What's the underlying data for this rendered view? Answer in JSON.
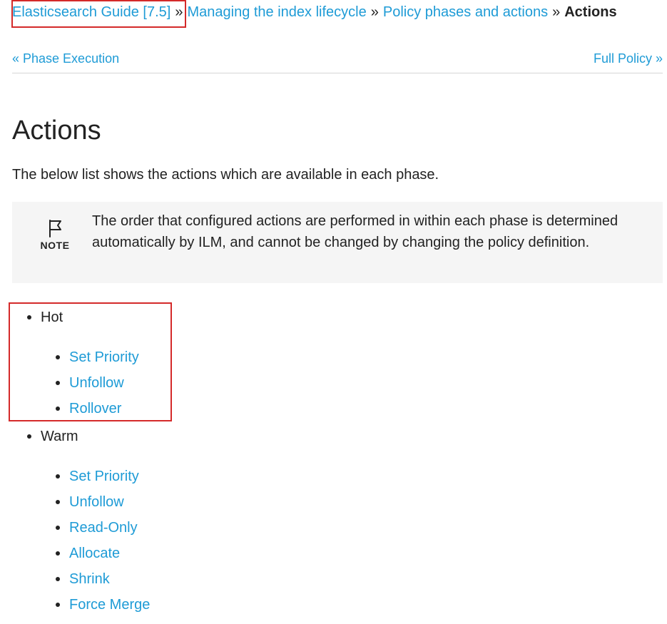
{
  "breadcrumb": {
    "items": [
      "Elasticsearch Guide [7.5]",
      "Managing the index lifecycle",
      "Policy phases and actions"
    ],
    "separator": "»",
    "current": "Actions"
  },
  "nav": {
    "prev": "« Phase Execution",
    "next": "Full Policy »"
  },
  "page": {
    "title": "Actions",
    "intro": "The below list shows the actions which are available in each phase."
  },
  "note": {
    "label": "NOTE",
    "icon": "flag-icon",
    "text": "The order that configured actions are performed in within each phase is determined automatically by ILM, and cannot be changed by changing the policy definition."
  },
  "phases": [
    {
      "name": "Hot",
      "actions": [
        "Set Priority",
        "Unfollow",
        "Rollover"
      ]
    },
    {
      "name": "Warm",
      "actions": [
        "Set Priority",
        "Unfollow",
        "Read-Only",
        "Allocate",
        "Shrink",
        "Force Merge"
      ]
    }
  ],
  "colors": {
    "link": "#1e9bd6",
    "text": "#222222",
    "note_background": "#f5f5f5",
    "highlight": "#d42a2a"
  }
}
